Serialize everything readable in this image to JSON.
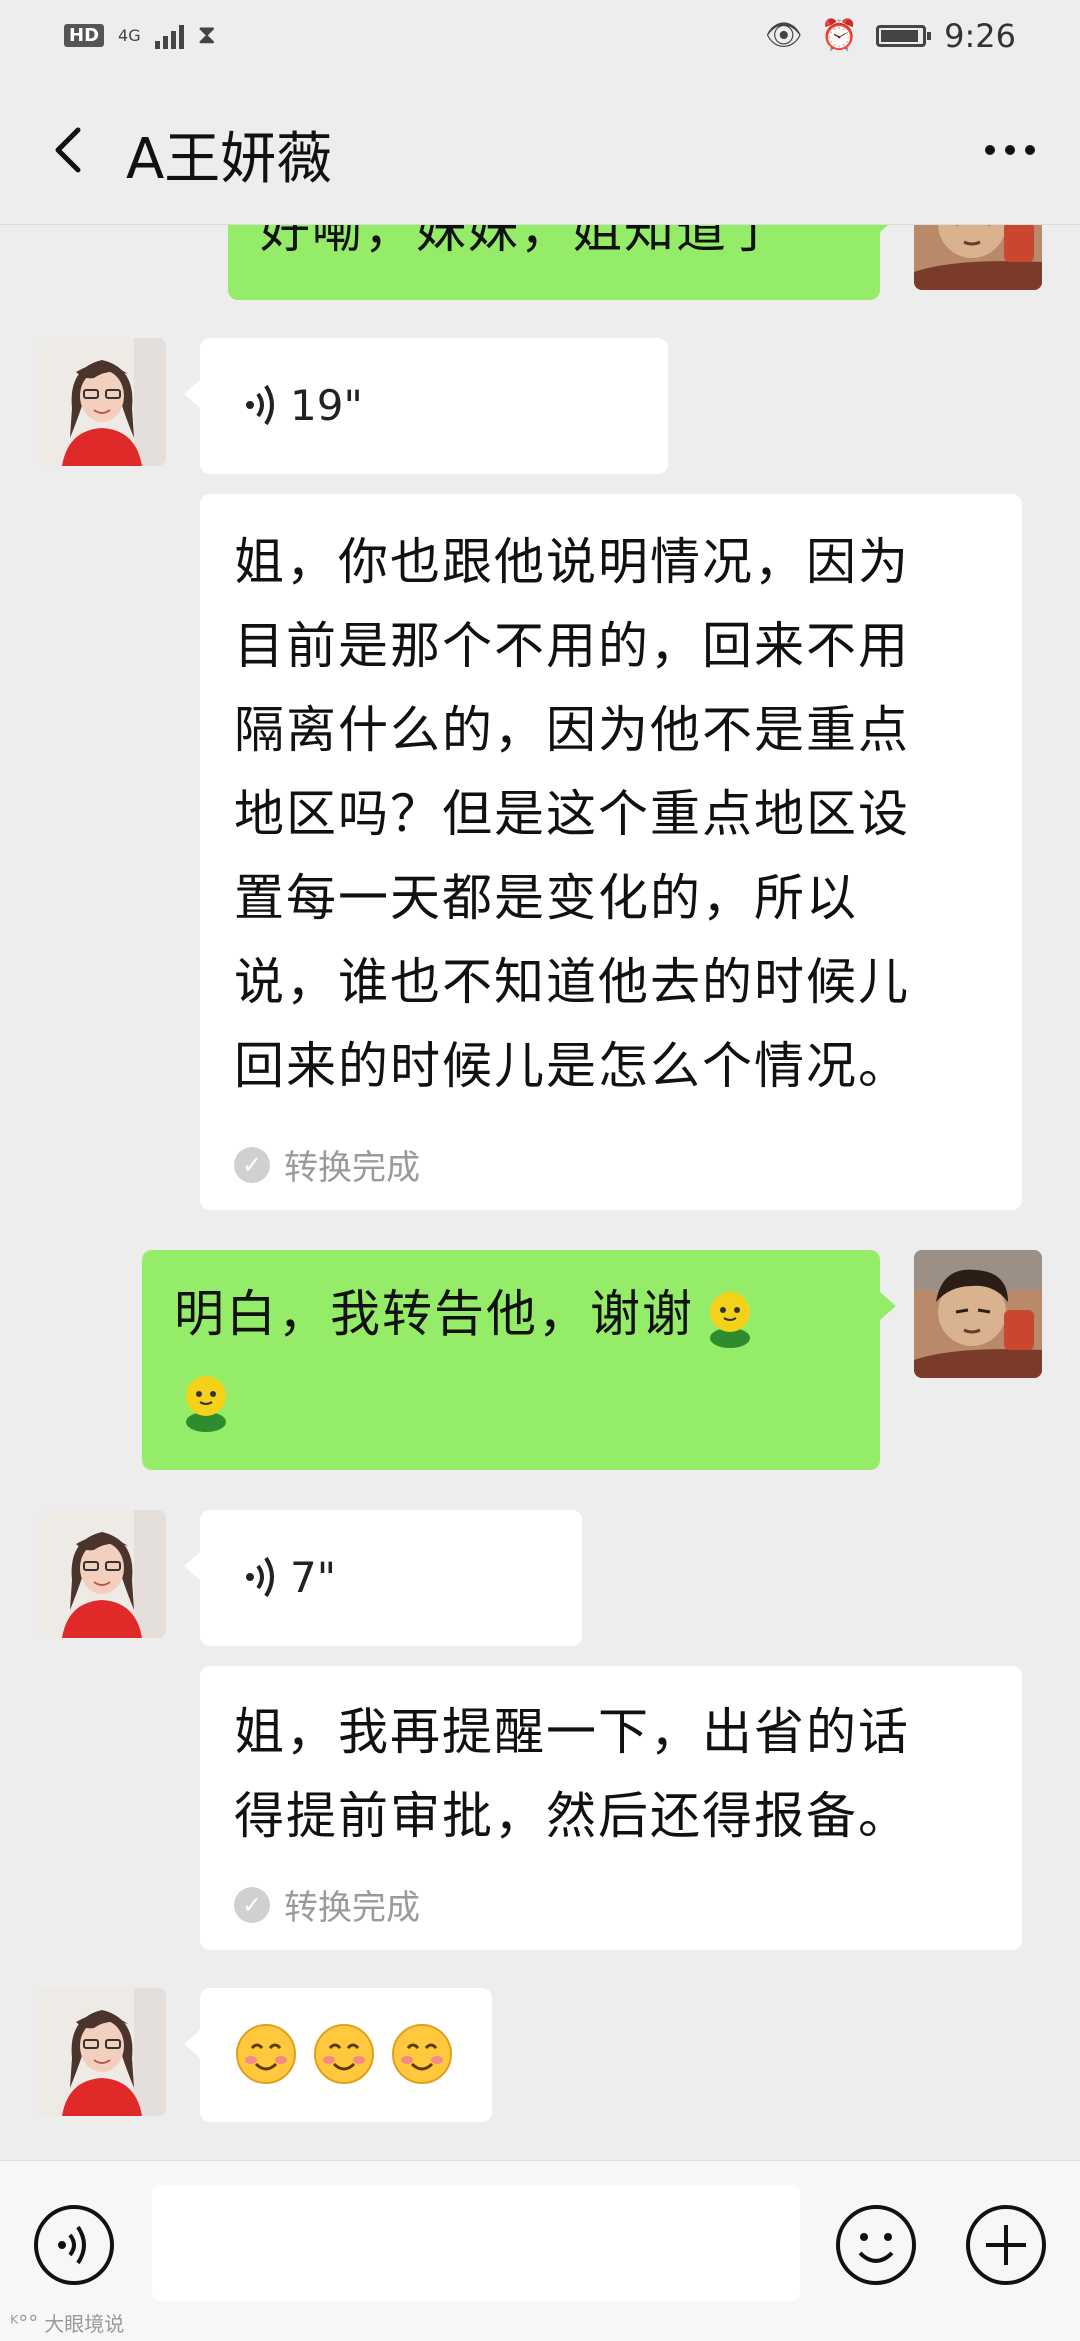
{
  "status_bar": {
    "hd": "HD",
    "network": "4G",
    "signal_level": 4,
    "hourglass_icon": "hourglass-icon",
    "eye_icon": "eye-comfort-icon",
    "alarm_icon": "alarm-icon",
    "battery_level": 0.92,
    "time": "9:26"
  },
  "header": {
    "back_icon": "chevron-left-icon",
    "title": "A王妍薇",
    "more_icon": "more-dots-icon"
  },
  "messages": [
    {
      "side": "out",
      "type": "text",
      "text": "好嘞，妹妹，姐知道了"
    },
    {
      "side": "in",
      "type": "voice",
      "duration": "19\""
    },
    {
      "side": "in",
      "type": "transcript",
      "lines": [
        "姐，你也跟他说明情况，因为",
        "目前是那个不用的，回来不用",
        "隔离什么的，因为他不是重点",
        "地区吗？但是这个重点地区设",
        "置每一天都是变化的，所以",
        "说，谁也不知道他去的时候儿",
        "回来的时候儿是怎么个情况。"
      ],
      "status": "转换完成"
    },
    {
      "side": "out",
      "type": "text",
      "text": "明白，我转告他，谢谢"
    },
    {
      "side": "in",
      "type": "voice",
      "duration": "7\""
    },
    {
      "side": "in",
      "type": "transcript",
      "lines": [
        "姐，我再提醒一下，出省的话",
        "得提前审批，然后还得报备。"
      ],
      "status": "转换完成"
    },
    {
      "side": "in",
      "type": "emoji",
      "emoji": [
        "smiling-blush-emoji",
        "smiling-blush-emoji",
        "smiling-blush-emoji"
      ]
    }
  ],
  "input_bar": {
    "voice_icon": "voice-input-icon",
    "placeholder": "",
    "emoji_icon": "emoji-icon",
    "plus_icon": "plus-icon"
  },
  "watermark": {
    "text": "大眼境说"
  },
  "colors": {
    "background": "#ededed",
    "outgoing_bubble": "#95ec69",
    "incoming_bubble": "#ffffff",
    "input_bar": "#f7f7f7"
  }
}
